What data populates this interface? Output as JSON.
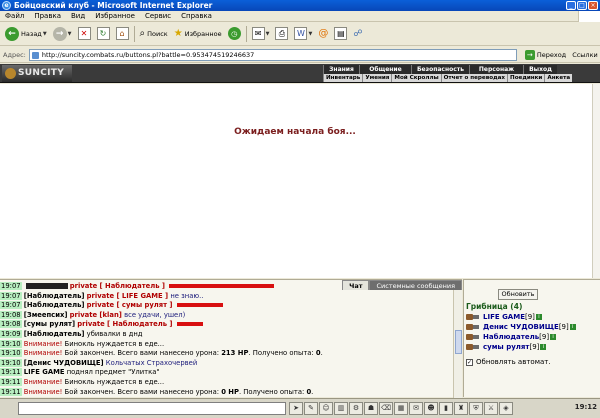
{
  "window": {
    "title": "Бойцовский клуб - Microsoft Internet Explorer",
    "buttons": {
      "minimize": "_",
      "maximize": "□",
      "close": "×"
    }
  },
  "menubar": [
    "Файл",
    "Правка",
    "Вид",
    "Избранное",
    "Сервис",
    "Справка"
  ],
  "toolbar": {
    "back": "Назад",
    "search": "Поиск",
    "favorites": "Избранное",
    "icons": [
      "back-arrow-icon",
      "forward-arrow-icon",
      "stop-icon",
      "refresh-icon",
      "home-icon",
      "search-icon",
      "favorites-star-icon",
      "history-icon",
      "mail-icon",
      "print-icon",
      "edit-icon",
      "messenger-icon",
      "research-icon",
      "contacts-icon"
    ]
  },
  "address": {
    "label": "Адрес:",
    "url": "http://suncity.combats.ru/buttons.pl?battle=0.953474519246637",
    "go": "Переход",
    "links": "Ссылки"
  },
  "game": {
    "logo": "SUNCITY",
    "nav_top": [
      "Знания",
      "Общение",
      "Безопасность",
      "Персонаж",
      "Выход"
    ],
    "nav_bottom": [
      "Инвентарь",
      "Умения",
      "Мой Скроллы",
      "Отчет о переводах",
      "Поединки",
      "Анкета"
    ],
    "waiting_message": "Ожидаем начала боя..."
  },
  "chat": {
    "tabs": {
      "chat": "Чат",
      "system": "Системные сообщения"
    },
    "lines": [
      {
        "time": "19:07",
        "nick": "",
        "private_to": "private [ Наблюдатель ]",
        "text": "",
        "style": "redbar-long",
        "hidden_nick": true
      },
      {
        "time": "19:07",
        "nick": "[Наблюдатель]",
        "private_to": "private [ LIFE GAME ]",
        "text": "не знаю..",
        "style": "normal"
      },
      {
        "time": "19:07",
        "nick": "[Наблюдатель]",
        "private_to": "private [ сумы рулят ]",
        "text": "",
        "style": "redbar-mid"
      },
      {
        "time": "19:08",
        "nick": "[Змеепсих]",
        "private_to": "private [klan]",
        "text": "все удачи, ушел)",
        "style": "normal"
      },
      {
        "time": "19:08",
        "nick": "[сумы рулят]",
        "private_to": "private [ Наблюдатель ]",
        "text": "",
        "style": "redbar-short"
      },
      {
        "time": "19:09",
        "nick": "[Наблюдатель]",
        "private_to": "",
        "text": "убивалки в днд",
        "style": "normal"
      },
      {
        "time": "19:10",
        "nick": "",
        "private_to": "",
        "warn": "Внимание!",
        "text": "Бинокль нуждается в еде...",
        "style": "warning"
      },
      {
        "time": "19:10",
        "nick": "",
        "private_to": "",
        "warn": "Внимание!",
        "text": "Бой закончен. Всего вами нанесено урона: ",
        "bold": "213 HP",
        "text2": ". Получено опыта: ",
        "bold2": "0",
        "text3": ".",
        "style": "warning"
      },
      {
        "time": "19:10",
        "nick": "[Денис ЧУДОВИЩЕ]",
        "private_to": "",
        "text": "Кольчатых Страхочервей",
        "style": "blue"
      },
      {
        "time": "19:11",
        "nick": "LIFE GAME",
        "private_to": "",
        "text": "поднял предмет \"Улитка\"",
        "style": "pickup"
      },
      {
        "time": "19:11",
        "nick": "",
        "private_to": "",
        "warn": "Внимание!",
        "text": "Бинокль нуждается в еде...",
        "style": "warning"
      },
      {
        "time": "19:11",
        "nick": "",
        "private_to": "",
        "warn": "Внимание!",
        "text": "Бой закончен. Всего вами нанесено урона: ",
        "bold": "0 HP",
        "text2": ". Получено опыта: ",
        "bold2": "0",
        "text3": ".",
        "style": "warning"
      }
    ]
  },
  "room": {
    "refresh": "Обновить",
    "title": "Грибница (4)",
    "players": [
      {
        "name": "LIFE GAME",
        "level": "[9]",
        "info": "i"
      },
      {
        "name": "Денис ЧУДОВИЩЕ",
        "level": "[9]",
        "info": "i"
      },
      {
        "name": "Наблюдатель",
        "level": "[9]",
        "info": "i"
      },
      {
        "name": "сумы рулят",
        "level": "[9]",
        "info": "i"
      }
    ],
    "auto_refresh": "Обновлять автомат."
  },
  "statusbar": {
    "clock": "19:12"
  }
}
